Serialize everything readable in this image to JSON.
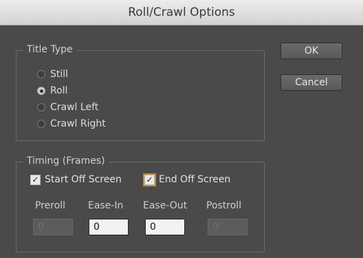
{
  "window": {
    "title": "Roll/Crawl Options"
  },
  "title_type": {
    "legend": "Title Type",
    "options": [
      {
        "label": "Still",
        "selected": false
      },
      {
        "label": "Roll",
        "selected": true
      },
      {
        "label": "Crawl Left",
        "selected": false
      },
      {
        "label": "Crawl Right",
        "selected": false
      }
    ]
  },
  "timing": {
    "legend": "Timing (Frames)",
    "start_off_screen": {
      "label": "Start Off Screen",
      "checked": true
    },
    "end_off_screen": {
      "label": "End Off Screen",
      "checked": true
    },
    "fields": [
      {
        "label": "Preroll",
        "value": "0",
        "enabled": false
      },
      {
        "label": "Ease-In",
        "value": "0",
        "enabled": true
      },
      {
        "label": "Ease-Out",
        "value": "0",
        "enabled": true
      },
      {
        "label": "Postroll",
        "value": "0",
        "enabled": false
      }
    ]
  },
  "buttons": {
    "ok": "OK",
    "cancel": "Cancel"
  },
  "check_glyph": "✓"
}
